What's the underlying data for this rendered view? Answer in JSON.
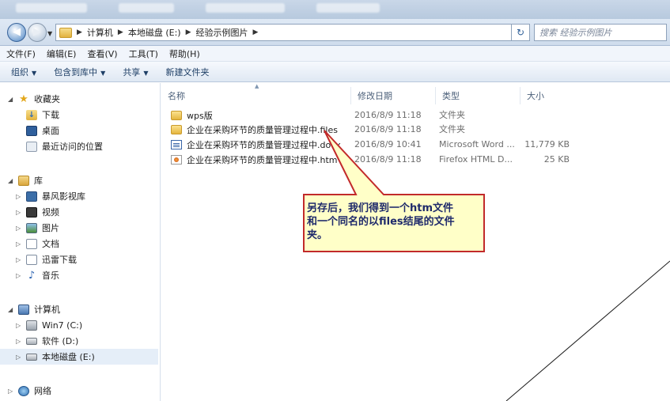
{
  "address": {
    "segments": [
      "计算机",
      "本地磁盘 (E:)",
      "经验示例图片"
    ],
    "search_placeholder": "搜索 经验示例图片"
  },
  "menu": [
    "文件(F)",
    "编辑(E)",
    "查看(V)",
    "工具(T)",
    "帮助(H)"
  ],
  "toolbar": {
    "organize": "组织",
    "include_library": "包含到库中",
    "share": "共享",
    "new_folder": "新建文件夹"
  },
  "nav": {
    "favorites": "收藏夹",
    "downloads": "下载",
    "desktop": "桌面",
    "recent": "最近访问的位置",
    "libraries": "库",
    "baofeng": "暴风影视库",
    "videos": "视频",
    "pictures": "图片",
    "documents": "文档",
    "xunlei": "迅雷下载",
    "music": "音乐",
    "computer": "计算机",
    "drive_c": "Win7 (C:)",
    "drive_d": "软件 (D:)",
    "drive_e": "本地磁盘 (E:)",
    "network": "网络"
  },
  "columns": {
    "name": "名称",
    "date": "修改日期",
    "type": "类型",
    "size": "大小"
  },
  "files": [
    {
      "name": "wps版",
      "date": "2016/8/9 11:18",
      "type": "文件夹",
      "size": "",
      "icon": "folder"
    },
    {
      "name": "企业在采购环节的质量管理过程中.files",
      "date": "2016/8/9 11:18",
      "type": "文件夹",
      "size": "",
      "icon": "folder"
    },
    {
      "name": "企业在采购环节的质量管理过程中.docx",
      "date": "2016/8/9 10:41",
      "type": "Microsoft Word ...",
      "size": "11,779 KB",
      "icon": "doc"
    },
    {
      "name": "企业在采购环节的质量管理过程中.htm",
      "date": "2016/8/9 11:18",
      "type": "Firefox HTML D...",
      "size": "25 KB",
      "icon": "htm"
    }
  ],
  "callout": {
    "line1": "另存后，我们得到一个htm文件",
    "line2": "和一个同名的以files结尾的文件",
    "line3": "夹。",
    "fill": "#ffffc8",
    "border": "#c22a2a"
  }
}
